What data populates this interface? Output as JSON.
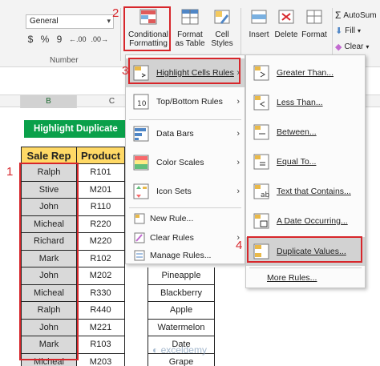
{
  "ribbon": {
    "number_format": "General",
    "number_buttons": [
      "$",
      "%",
      "9",
      "←.00",
      ".00→"
    ],
    "number_group_label": "Number",
    "conditional_formatting_label": "Conditional Formatting",
    "format_as_table_label": "Format as Table",
    "cell_styles_label": "Cell Styles",
    "insert_label": "Insert",
    "delete_label": "Delete",
    "format_label": "Format",
    "autosum_label": "AutoSum",
    "fill_label": "Fill",
    "clear_label": "Clear"
  },
  "steps": {
    "one": "1",
    "two": "2",
    "three": "3",
    "four": "4"
  },
  "columns": [
    "B",
    "C"
  ],
  "sheet": {
    "title": "Highlight Duplicate",
    "headers": {
      "rep": "Sale Rep",
      "product": "Product"
    },
    "rows": [
      {
        "rep": "Ralph",
        "product": "R101",
        "item": ""
      },
      {
        "rep": "Stive",
        "product": "M201",
        "item": ""
      },
      {
        "rep": "John",
        "product": "R110",
        "item": ""
      },
      {
        "rep": "Micheal",
        "product": "R220",
        "item": ""
      },
      {
        "rep": "Richard",
        "product": "M220",
        "item": ""
      },
      {
        "rep": "Mark",
        "product": "R102",
        "item": ""
      },
      {
        "rep": "John",
        "product": "M202",
        "item": "Pineapple"
      },
      {
        "rep": "Micheal",
        "product": "R330",
        "item": "Blackberry"
      },
      {
        "rep": "Ralph",
        "product": "R440",
        "item": "Apple"
      },
      {
        "rep": "John",
        "product": "M221",
        "item": "Watermelon"
      },
      {
        "rep": "Mark",
        "product": "R103",
        "item": "Date"
      },
      {
        "rep": "Micheal",
        "product": "M203",
        "item": "Grape"
      }
    ]
  },
  "cf_menu": {
    "highlight": "Highlight Cells Rules",
    "topbottom": "Top/Bottom Rules",
    "databars": "Data Bars",
    "colorscales": "Color Scales",
    "iconsets": "Icon Sets",
    "newrule": "New Rule...",
    "clearrules": "Clear Rules",
    "managerules": "Manage Rules..."
  },
  "sub_menu": {
    "greater": "Greater Than...",
    "less": "Less Than...",
    "between": "Between...",
    "equal": "Equal To...",
    "text": "Text that Contains...",
    "date": "A Date Occurring...",
    "dup": "Duplicate Values...",
    "more": "More Rules..."
  },
  "watermark": "exceldemy",
  "colors": {
    "accent_red": "#d7262b",
    "banner_green": "#0aa04a",
    "header_yellow": "#ffd966",
    "selected_gray": "#d9d9d9"
  }
}
